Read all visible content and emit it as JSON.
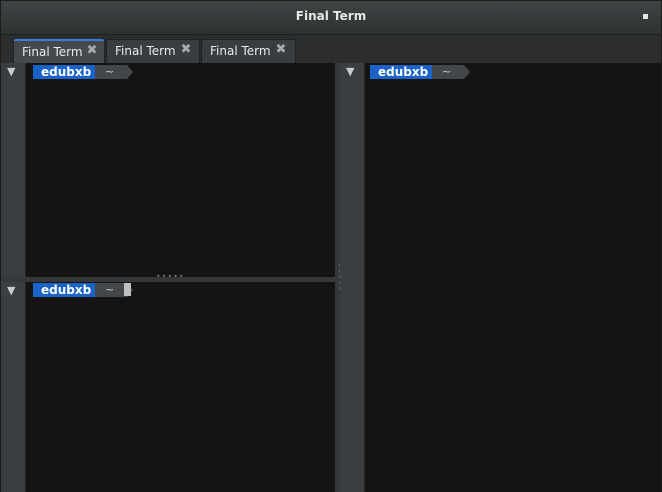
{
  "window": {
    "title": "Final Term"
  },
  "tabs": [
    {
      "label": "Final Term",
      "active": true
    },
    {
      "label": "Final Term",
      "active": false
    },
    {
      "label": "Final Term",
      "active": false
    }
  ],
  "icons": {
    "tab_close": "close-icon",
    "collapse": "triangle-down-icon",
    "window_control": "square-icon"
  },
  "panes": {
    "top_left": {
      "user": "edubxb",
      "dir": "~"
    },
    "bottom_left": {
      "user": "edubxb",
      "dir": "~",
      "cursor": true
    },
    "right": {
      "user": "edubxb",
      "dir": "~"
    }
  },
  "glyphs": {
    "close": "✖",
    "collapse": "▼"
  },
  "colors": {
    "accent": "#1a63c9",
    "terminal_bg": "#141414",
    "tab_active_border": "#3c7bd6"
  }
}
